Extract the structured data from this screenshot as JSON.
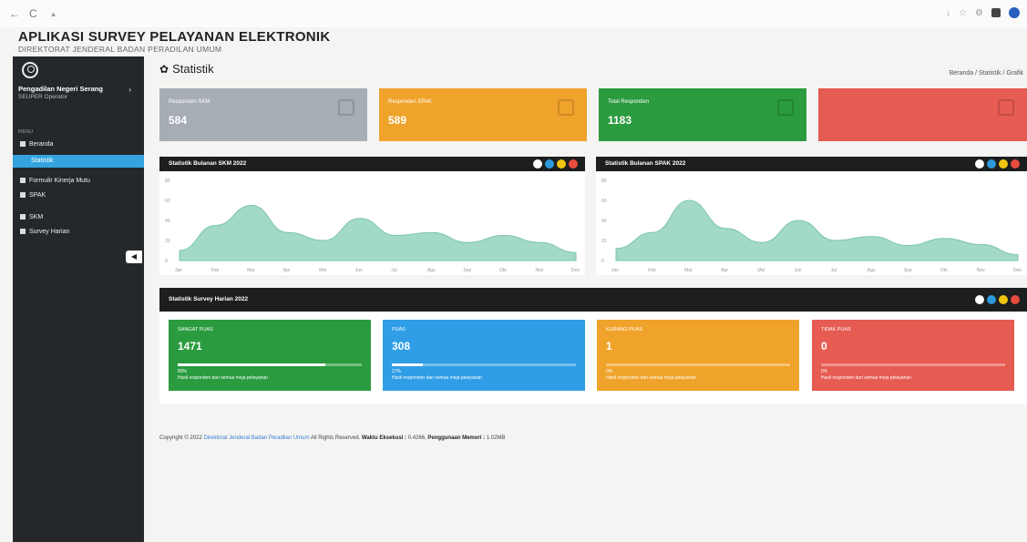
{
  "browser": {
    "back": "←",
    "reload": "C"
  },
  "app": {
    "title": "APLIKASI SURVEY PELAYANAN ELEKTRONIK",
    "subtitle": "DIREKTORAT JENDERAL BADAN PERADILAN UMUM"
  },
  "sidebar": {
    "user_name": "Pengadilan Negeri Serang",
    "role": "SEUPER Operator",
    "items": [
      {
        "label": "Beranda"
      },
      {
        "label": "Statistik"
      },
      {
        "label": "Formulir Kinerja Mutu"
      },
      {
        "label": "SPAK"
      },
      {
        "label": "SKM"
      },
      {
        "label": "Survey Harian"
      }
    ]
  },
  "page": {
    "title": "Statistik",
    "breadcrumb": "Beranda / Statistik / Grafik"
  },
  "tiles": [
    {
      "label": "Responden SKM",
      "value": "584",
      "color": "#a6adb5"
    },
    {
      "label": "Responden SPAK",
      "value": "589",
      "color": "#f0a32b"
    },
    {
      "label": "Total Responden",
      "value": "1183",
      "color": "#2a9b3f"
    },
    {
      "label": "",
      "value": "",
      "color": "#e65b52"
    }
  ],
  "charts": {
    "left_title": "Statistik Bulanan SKM 2022",
    "right_title": "Statistik Bulanan SPAK 2022",
    "survey_title": "Statistik Survey Harian 2022",
    "dot_colors": [
      "#ffffff",
      "#2d98da",
      "#f1c40f",
      "#e74c3c"
    ]
  },
  "chart_data": [
    {
      "type": "area",
      "title": "Statistik Bulanan SKM 2022",
      "categories": [
        "Jan",
        "Feb",
        "Mar",
        "Apr",
        "Mei",
        "Jun",
        "Jul",
        "Agu",
        "Sep",
        "Okt",
        "Nov",
        "Des"
      ],
      "values": [
        10,
        35,
        55,
        28,
        20,
        42,
        25,
        28,
        18,
        25,
        18,
        8
      ],
      "ylim": [
        0,
        80
      ],
      "color": "#a3d9c9"
    },
    {
      "type": "area",
      "title": "Statistik Bulanan SPAK 2022",
      "categories": [
        "Jan",
        "Feb",
        "Mar",
        "Apr",
        "Mei",
        "Jun",
        "Jul",
        "Agu",
        "Sep",
        "Okt",
        "Nov",
        "Des"
      ],
      "values": [
        12,
        28,
        60,
        32,
        18,
        40,
        20,
        24,
        15,
        22,
        16,
        6
      ],
      "ylim": [
        0,
        80
      ],
      "color": "#a3d9c9"
    }
  ],
  "survey_stats": [
    {
      "label": "SANGAT PUAS",
      "value": "1471",
      "progress_pct": 80,
      "color": "#2a9b3f"
    },
    {
      "label": "PUAS",
      "value": "308",
      "progress_pct": 17,
      "color": "#2f9ee6"
    },
    {
      "label": "KURANG PUAS",
      "value": "1",
      "progress_pct": 0,
      "color": "#f0a32b"
    },
    {
      "label": "TIDAK PUAS",
      "value": "0",
      "progress_pct": 0,
      "color": "#e65b52"
    }
  ],
  "footer": {
    "prefix": "Copyright © 2022",
    "link": "Direktorat Jenderal Badan Peradilan Umum",
    "rights": "All Rights Reserved.",
    "exec_label": "Waktu Eksekusi :",
    "exec_value": "0.4266",
    "mem_label": "Penggunaan Memori :",
    "mem_value": "1.02MB"
  }
}
